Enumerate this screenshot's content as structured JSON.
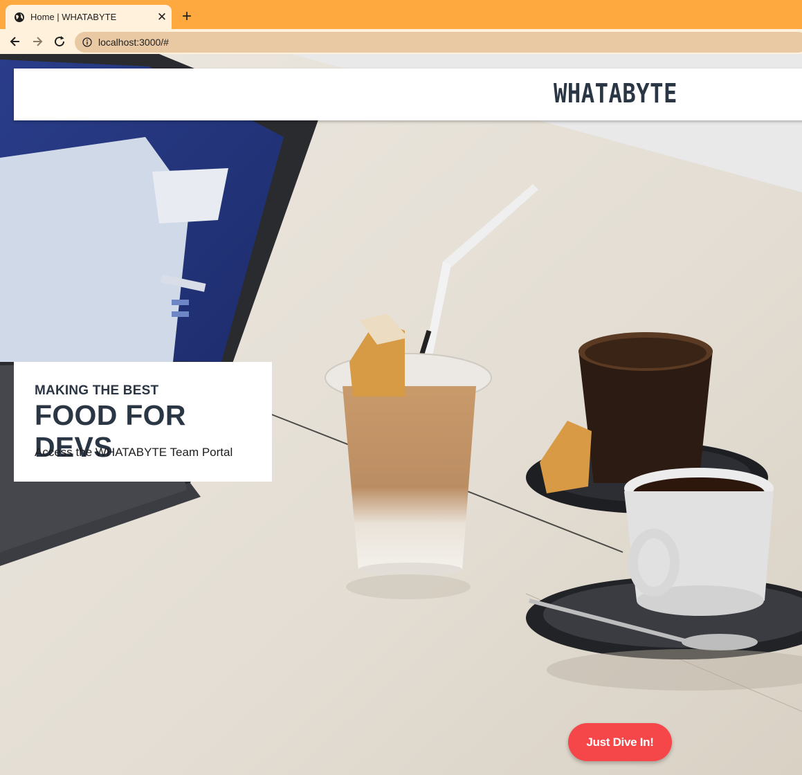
{
  "browser": {
    "tab": {
      "title": "Home | WHATABYTE",
      "favicon": "globe-icon",
      "close_icon": "close-icon"
    },
    "new_tab_icon": "plus-icon",
    "nav": {
      "back_icon": "arrow-left-icon",
      "forward_icon": "arrow-right-icon",
      "reload_icon": "reload-icon"
    },
    "address_bar": {
      "icon": "info-icon",
      "url": "localhost:3000/#"
    },
    "colors": {
      "tabstrip": "#fea93f",
      "toolbar": "#fff1dc",
      "omnibox": "#e9c9a4"
    }
  },
  "page": {
    "navbar": {
      "brand": "WHATABYTE"
    },
    "hero": {
      "kicker": "MAKING THE BEST",
      "headline": "FOOD FOR DEVS",
      "portal_link": "Access the WHATABYTE Team Portal"
    },
    "cta": {
      "label": "Just Dive In!"
    },
    "colors": {
      "text_dark": "#2b3645",
      "cta": "#f54749",
      "card": "#ffffff"
    }
  }
}
